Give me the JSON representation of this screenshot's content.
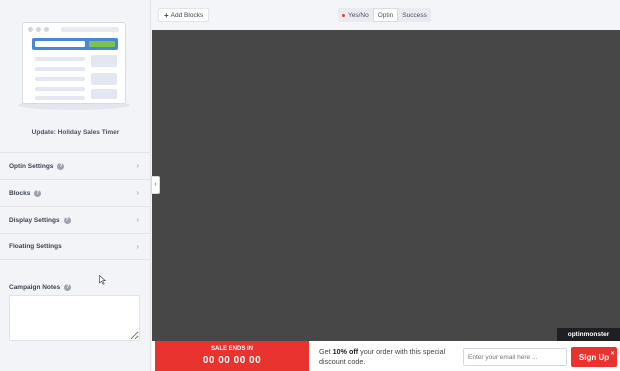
{
  "sidebar": {
    "campaign_title": "Update: Holiday Sales Timer",
    "settings": [
      {
        "label": "Optin Settings",
        "help": "?"
      },
      {
        "label": "Blocks",
        "help": "?"
      },
      {
        "label": "Display Settings",
        "help": "?"
      },
      {
        "label": "Floating Settings",
        "help": ""
      }
    ],
    "chevron": "›",
    "notes_label": "Campaign Notes",
    "notes_help": "?"
  },
  "toolbar": {
    "add_blocks_icon": "+",
    "add_blocks_label": "Add Blocks",
    "view_tabs": [
      "Yes/No",
      "Optin",
      "Success"
    ],
    "active_tab": "Optin"
  },
  "canvas": {
    "collapse_icon": "‹",
    "badge": "optinmonster"
  },
  "floatbar": {
    "sale_label": "SALE ENDS IN",
    "timer": "00 00 00 00",
    "offer_prefix": "Get ",
    "offer_bold": "10% off",
    "offer_suffix": " your order with this special discount code.",
    "email_placeholder": "Enter your email here ...",
    "signup_label": "Sign Up",
    "close_icon": "✕"
  },
  "colors": {
    "accent": "#e8332e",
    "canvas_bg": "#474747",
    "sidebar_bg": "#f3f4f8"
  }
}
